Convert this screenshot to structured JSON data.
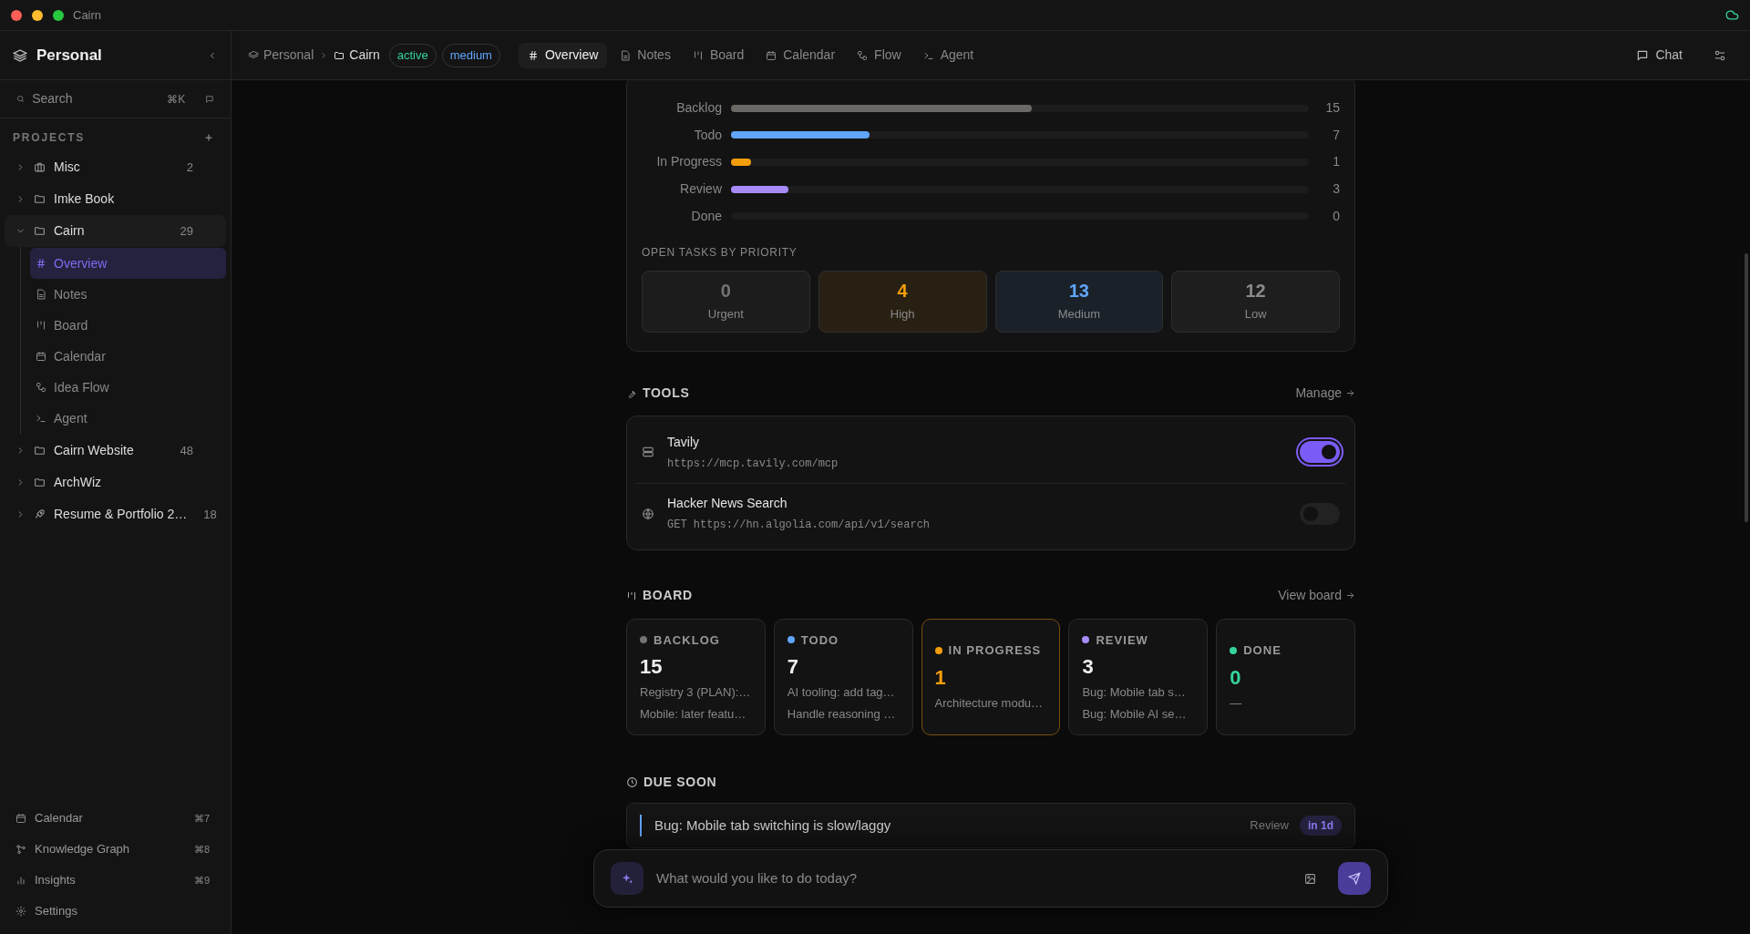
{
  "window": {
    "title": "Cairn"
  },
  "sidebar": {
    "workspace": "Personal",
    "search": {
      "placeholder": "Search",
      "shortcut": "⌘K"
    },
    "projects_heading": "PROJECTS",
    "projects": [
      {
        "name": "Misc",
        "count": "2",
        "expanded": false
      },
      {
        "name": "Imke Book",
        "expanded": false
      },
      {
        "name": "Cairn",
        "count": "29",
        "expanded": true,
        "children": [
          {
            "label": "Overview",
            "selected": true
          },
          {
            "label": "Notes",
            "selected": false
          },
          {
            "label": "Board",
            "selected": false
          },
          {
            "label": "Calendar",
            "selected": false
          },
          {
            "label": "Idea Flow",
            "selected": false
          },
          {
            "label": "Agent",
            "selected": false
          }
        ]
      },
      {
        "name": "Cairn Website",
        "count": "48",
        "expanded": false
      },
      {
        "name": "ArchWiz",
        "expanded": false
      },
      {
        "name": "Resume & Portfolio 2…",
        "count": "18",
        "expanded": false
      }
    ],
    "footer": [
      {
        "label": "Calendar",
        "shortcut": "⌘7"
      },
      {
        "label": "Knowledge Graph",
        "shortcut": "⌘8"
      },
      {
        "label": "Insights",
        "shortcut": "⌘9"
      },
      {
        "label": "Settings"
      }
    ]
  },
  "breadcrumb": [
    "Personal",
    "Cairn"
  ],
  "badges": [
    {
      "label": "active",
      "color": "#34d399"
    },
    {
      "label": "medium",
      "color": "#60a5fa"
    }
  ],
  "tabs": [
    {
      "label": "Overview",
      "selected": true
    },
    {
      "label": "Notes",
      "selected": false
    },
    {
      "label": "Board",
      "selected": false
    },
    {
      "label": "Calendar",
      "selected": false
    },
    {
      "label": "Flow",
      "selected": false
    },
    {
      "label": "Agent",
      "selected": false
    }
  ],
  "chat_button": "Chat",
  "status": {
    "rows": [
      {
        "label": "Backlog",
        "count": "15",
        "level": 0.52,
        "color": "#6b6866"
      },
      {
        "label": "Todo",
        "count": "7",
        "level": 0.24,
        "color": "#60a5fa"
      },
      {
        "label": "In Progress",
        "count": "1",
        "level": 0.034,
        "color": "#f59e0b"
      },
      {
        "label": "Review",
        "count": "3",
        "level": 0.1,
        "color": "#a78bfa"
      },
      {
        "label": "Done",
        "count": "0"
      }
    ]
  },
  "priority": {
    "heading": "OPEN TASKS BY PRIORITY",
    "items": [
      {
        "count": "0",
        "label": "Urgent",
        "color": "#737373"
      },
      {
        "count": "4",
        "label": "High",
        "color": "#f59e0b"
      },
      {
        "count": "13",
        "label": "Medium",
        "color": "#60a5fa"
      },
      {
        "count": "12",
        "label": "Low",
        "color": "#8a8a8a"
      }
    ]
  },
  "tools": {
    "heading": "TOOLS",
    "action": "Manage",
    "items": [
      {
        "name": "Tavily",
        "url": "https://mcp.tavily.com/mcp",
        "on": true
      },
      {
        "name": "Hacker News Search",
        "url": "GET https://hn.algolia.com/api/v1/search",
        "on": false
      }
    ]
  },
  "board": {
    "heading": "BOARD",
    "action": "View board",
    "columns": [
      {
        "name": "BACKLOG",
        "count": "15",
        "color": "#737373",
        "selected": false,
        "items": [
          "Registry 3 (PLAN):…",
          "Mobile: later featu…"
        ]
      },
      {
        "name": "TODO",
        "count": "7",
        "color": "#60a5fa",
        "selected": false,
        "items": [
          "AI tooling: add tag…",
          "Handle reasoning …"
        ]
      },
      {
        "name": "IN PROGRESS",
        "count": "1",
        "color": "#f59e0b",
        "selected": true,
        "items": [
          "Architecture modu…"
        ]
      },
      {
        "name": "REVIEW",
        "count": "3",
        "color": "#a78bfa",
        "selected": false,
        "items": [
          "Bug: Mobile tab s…",
          "Bug: Mobile AI se…"
        ]
      },
      {
        "name": "DONE",
        "count": "0",
        "color": "#34d399",
        "selected": false,
        "items": [
          "—"
        ]
      }
    ]
  },
  "due_soon": {
    "heading": "DUE SOON",
    "items": [
      {
        "title": "Bug: Mobile tab switching is slow/laggy",
        "status": "Review",
        "due": "in 1d",
        "color": "#60a5fa"
      }
    ]
  },
  "composer": {
    "placeholder": "What would you like to do today?"
  }
}
